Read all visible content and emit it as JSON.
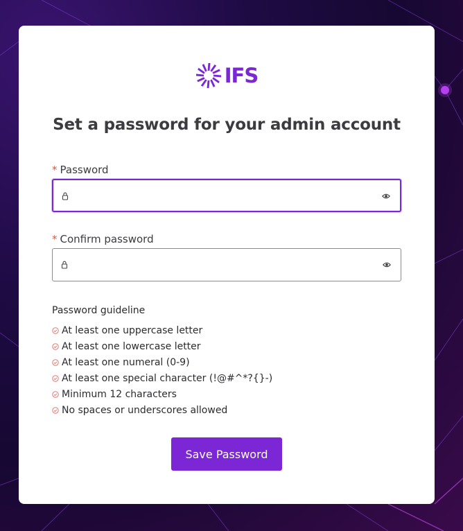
{
  "logo": {
    "text": "IFS",
    "icon": "ifs-swirl-icon"
  },
  "title": "Set a password for your admin account",
  "password": {
    "required_marker": "*",
    "label": "Password",
    "value": "",
    "lock_icon": "lock-icon",
    "toggle_icon": "eye-icon"
  },
  "confirm_password": {
    "required_marker": "*",
    "label": "Confirm password",
    "value": "",
    "lock_icon": "lock-icon",
    "toggle_icon": "eye-icon"
  },
  "guidelines": {
    "title": "Password guideline",
    "items": [
      {
        "text": "At least one uppercase letter",
        "icon": "check-circle-icon"
      },
      {
        "text": "At least one lowercase letter",
        "icon": "check-circle-icon"
      },
      {
        "text": "At least one numeral (0-9)",
        "icon": "check-circle-icon"
      },
      {
        "text": "At least one special character (!@#^*?{}-)",
        "icon": "check-circle-icon"
      },
      {
        "text": "Minimum 12 characters",
        "icon": "check-circle-icon"
      },
      {
        "text": "No spaces or underscores allowed",
        "icon": "check-circle-icon"
      }
    ]
  },
  "save_button": {
    "label": "Save Password"
  },
  "colors": {
    "accent": "#7b27d6",
    "required": "#e0553c",
    "guideline_icon": "#e07a6e",
    "text": "#3b3b40"
  }
}
